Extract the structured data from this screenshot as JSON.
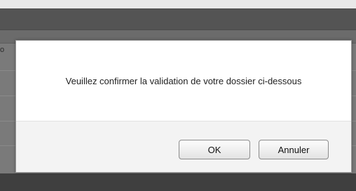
{
  "dialog": {
    "message": "Veuillez confirmer la validation de votre dossier ci-dessous",
    "ok_label": "OK",
    "cancel_label": "Annuler"
  },
  "background": {
    "partial_glyph": "o"
  }
}
